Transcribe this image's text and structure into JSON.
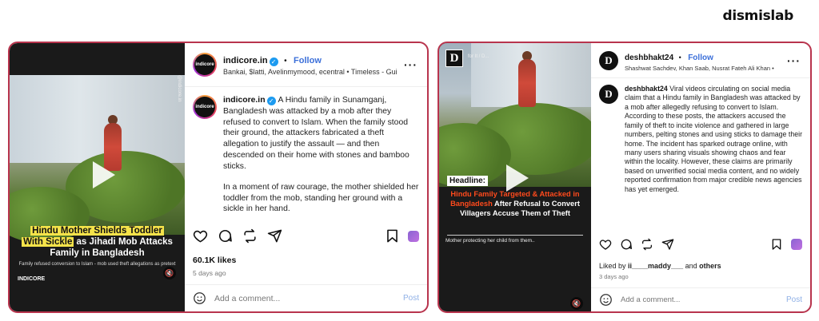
{
  "brand": "dismislab",
  "post1": {
    "username": "indicore.in",
    "follow_label": "Follow",
    "separator": "•",
    "subtitle": "Bankai, $latti, Avelinmymood, ecentral • Timeless - Gui",
    "avatar_text": "indicore",
    "caption_user": "indicore.in",
    "caption_p1": "A Hindu family in Sunamganj, Bangladesh was attacked by a mob after they refused to convert to Islam. When the family stood their ground, the attackers fabricated a theft allegation to justify the assault — and then descended on their home with stones and bamboo sticks.",
    "caption_p2": "In a moment of raw courage, the mother shielded her toddler from the mob, standing her ground with a sickle in her hand.",
    "likes": "60.1K likes",
    "time_ago": "5 days ago",
    "comment_placeholder": "Add a comment...",
    "post_label": "Post",
    "video": {
      "vertical_label": "@indicore.in",
      "headline_line1": "Hindu Mother Shields Toddler",
      "headline_hl": "With Sickle",
      "headline_rest": " as Jihadi Mob Attacks Family in Bangladesh",
      "subcaption": "Family refused conversion to Islam - mob used theft allegations as pretext",
      "logo": "INDICORE",
      "mute_icon": "🔇"
    }
  },
  "post2": {
    "username": "deshbhakt24",
    "follow_label": "Follow",
    "separator": "•",
    "subtitle": "Shashwat Sachdev, Khan Saab, Nusrat Fateh Ali Khan •",
    "avatar_text": "D",
    "caption_user": "deshbhakt24",
    "caption": "Viral videos circulating on social media claim that a Hindu family in Bangladesh was attacked by a mob after allegedly refusing to convert to Islam. According to these posts, the attackers accused the family of theft to incite violence and gathered in large numbers, pelting stones and using sticks to damage their home. The incident has sparked outrage online, with many users sharing visuals showing chaos and fear within the locality. However, these claims are primarily based on unverified social media content, and no widely reported confirmation from major credible news agencies has yet emerged.",
    "liked_by_prefix": "Liked by ",
    "liked_by_user": "ii____maddy___",
    "liked_by_and": " and ",
    "liked_by_others": "others",
    "time_ago": "3 days ago",
    "comment_placeholder": "Add a comment...",
    "post_label": "Post",
    "video": {
      "top_label": "for It / D...",
      "headline_label": "Headline:",
      "headline_red": "Hindu Family Targeted & Attacked in Bangladesh",
      "headline_white": " After Refusal to Convert Villagers Accuse Them of Theft",
      "subcaption": "Mother protecting her child from them..",
      "mute_icon": "🔇"
    }
  },
  "colors": {
    "card_border": "#b8344d",
    "follow": "#3b6fd9",
    "verified": "#1d9bf0",
    "headline_yellow": "#f5e34a",
    "headline_red": "#ff4a1c"
  }
}
